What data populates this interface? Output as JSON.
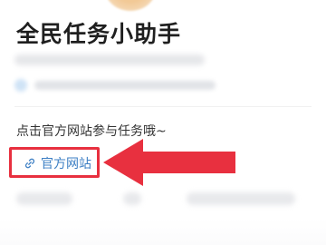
{
  "app": {
    "title": "全民任务小助手"
  },
  "section": {
    "prompt": "点击官方网站参与任务哦~",
    "official_link": {
      "label": "官方网站",
      "icon": "link-icon"
    }
  },
  "annotation": {
    "highlight_color": "#e8303f",
    "arrow_color": "#e8303f"
  },
  "colors": {
    "link": "#3d7fc4",
    "title": "#1f1f1f",
    "text": "#333333"
  }
}
